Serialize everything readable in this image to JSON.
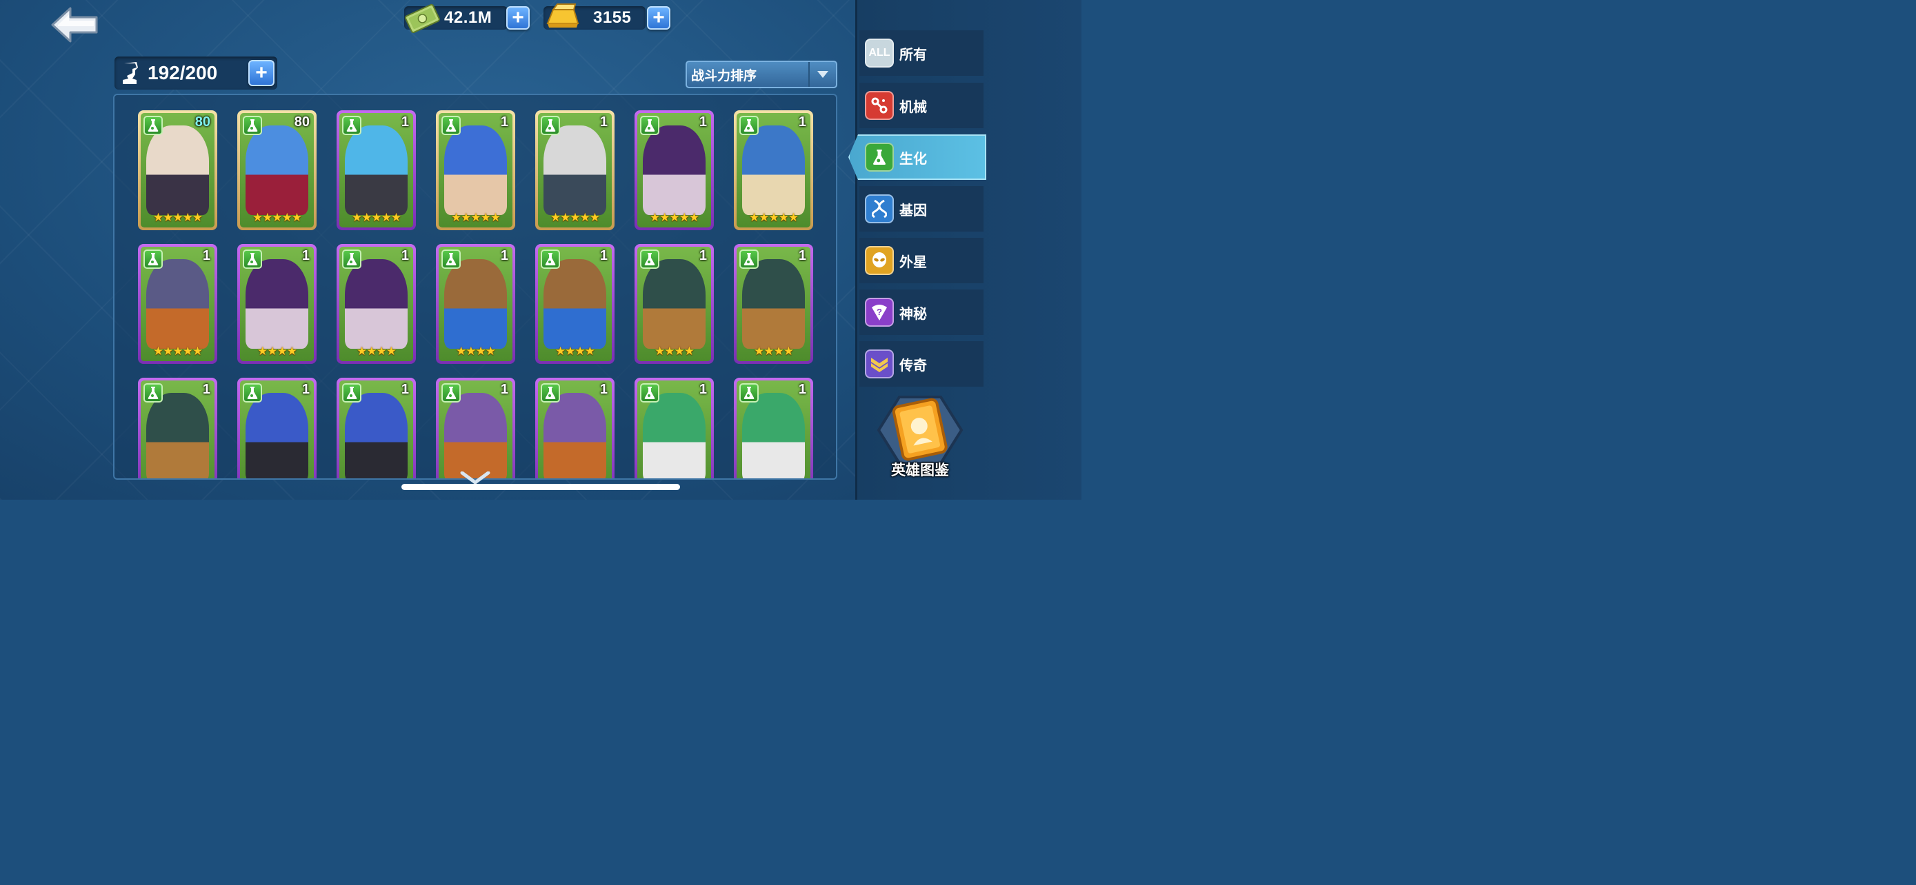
{
  "currency": {
    "cash": "42.1M",
    "gold": "3155"
  },
  "capacity": "192/200",
  "sort": {
    "label": "战斗力排序"
  },
  "categories": [
    {
      "label": "所有",
      "icon": "all-icon",
      "icon_text": "ALL",
      "color": "#c8d7de"
    },
    {
      "label": "机械",
      "icon": "mechanical-icon",
      "color": "#d63b32"
    },
    {
      "label": "生化",
      "icon": "flask-icon",
      "color": "#3aa83a",
      "active": true
    },
    {
      "label": "基因",
      "icon": "dna-icon",
      "color": "#2f7ed0"
    },
    {
      "label": "外星",
      "icon": "alien-icon",
      "color": "#e0a322"
    },
    {
      "label": "神秘",
      "icon": "mystery-icon",
      "color": "#8a3fc9"
    },
    {
      "label": "传奇",
      "icon": "legend-icon",
      "color": "#6a4fc9"
    }
  ],
  "collection_label": "英雄图鉴",
  "heroes": [
    [
      {
        "level": "80",
        "stars": 5,
        "rarity": "gold",
        "level_color": "cyan",
        "palette": [
          "#e8d9c9",
          "#3a3346"
        ]
      },
      {
        "level": "80",
        "stars": 5,
        "rarity": "gold",
        "palette": [
          "#4c8ee0",
          "#9a1f3a"
        ]
      },
      {
        "level": "1",
        "stars": 5,
        "rarity": "purple",
        "palette": [
          "#4fb6e8",
          "#3a3a44"
        ]
      },
      {
        "level": "1",
        "stars": 5,
        "rarity": "gold",
        "palette": [
          "#3d6fd6",
          "#e6c7a8"
        ]
      },
      {
        "level": "1",
        "stars": 5,
        "rarity": "gold",
        "palette": [
          "#d8d8d8",
          "#3a4a5a"
        ]
      },
      {
        "level": "1",
        "stars": 5,
        "rarity": "purple",
        "palette": [
          "#4b2a6b",
          "#d8c6d8"
        ]
      },
      {
        "level": "1",
        "stars": 5,
        "rarity": "gold",
        "palette": [
          "#3c78c8",
          "#e8d7b0"
        ]
      }
    ],
    [
      {
        "level": "1",
        "stars": 5,
        "rarity": "purple",
        "palette": [
          "#5a5a86",
          "#c46a2a"
        ]
      },
      {
        "level": "1",
        "stars": 4,
        "rarity": "purple",
        "palette": [
          "#4b2a6b",
          "#d8c6d8"
        ]
      },
      {
        "level": "1",
        "stars": 4,
        "rarity": "purple",
        "palette": [
          "#4b2a6b",
          "#d8c6d8"
        ]
      },
      {
        "level": "1",
        "stars": 4,
        "rarity": "purple",
        "palette": [
          "#9a6a3a",
          "#2f6ed0"
        ]
      },
      {
        "level": "1",
        "stars": 4,
        "rarity": "purple",
        "palette": [
          "#9a6a3a",
          "#2f6ed0"
        ]
      },
      {
        "level": "1",
        "stars": 4,
        "rarity": "purple",
        "palette": [
          "#2f4f4a",
          "#b07a3a"
        ]
      },
      {
        "level": "1",
        "stars": 4,
        "rarity": "purple",
        "palette": [
          "#2f4f4a",
          "#b07a3a"
        ]
      }
    ],
    [
      {
        "level": "1",
        "stars": 0,
        "rarity": "purple",
        "palette": [
          "#2f4f4a",
          "#b07a3a"
        ]
      },
      {
        "level": "1",
        "stars": 0,
        "rarity": "purple",
        "palette": [
          "#3a5ac8",
          "#2a2a33"
        ]
      },
      {
        "level": "1",
        "stars": 0,
        "rarity": "purple",
        "palette": [
          "#3a5ac8",
          "#2a2a33"
        ]
      },
      {
        "level": "1",
        "stars": 0,
        "rarity": "purple",
        "palette": [
          "#7a5aa8",
          "#c46a2a"
        ]
      },
      {
        "level": "1",
        "stars": 0,
        "rarity": "purple",
        "palette": [
          "#7a5aa8",
          "#c46a2a"
        ]
      },
      {
        "level": "1",
        "stars": 0,
        "rarity": "purple",
        "palette": [
          "#3aa86a",
          "#e8e8e8"
        ]
      },
      {
        "level": "1",
        "stars": 0,
        "rarity": "purple",
        "palette": [
          "#3aa86a",
          "#e8e8e8"
        ]
      }
    ]
  ]
}
